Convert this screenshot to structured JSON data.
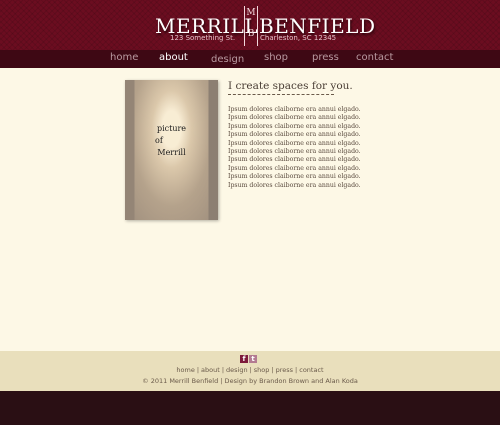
{
  "brand": {
    "name_left": "MERRILL",
    "name_right": "BENFIELD",
    "monogram_top": "M",
    "monogram_bottom": "B",
    "address_left": "123 Something St.",
    "address_right": "Charleston, SC 12345"
  },
  "nav": {
    "items": [
      {
        "label": "home",
        "active": false
      },
      {
        "label": "about",
        "active": true
      },
      {
        "label": "design",
        "active": false
      },
      {
        "label": "shop",
        "active": false
      },
      {
        "label": "press",
        "active": false
      },
      {
        "label": "contact",
        "active": false
      }
    ]
  },
  "photo": {
    "caption_line1": "picture",
    "caption_line2": "of",
    "caption_line3": "Merrill"
  },
  "content": {
    "heading": "I create spaces for you.",
    "body": "Ipsum dolores claiborne era annui elgado. Ipsum dolores claiborne era annui elgado. Ipsum dolores claiborne era annui elgado. Ipsum dolores claiborne era annui elgado. Ipsum dolores claiborne era annui elgado. Ipsum dolores claiborne era annui elgado. Ipsum dolores claiborne era annui elgado. Ipsum dolores claiborne era annui elgado. Ipsum dolores claiborne era annui elgado. Ipsum dolores claiborne era annui elgado."
  },
  "footer": {
    "social": {
      "facebook_glyph": "f",
      "twitter_glyph": "t"
    },
    "links": [
      "home",
      "about",
      "design",
      "shop",
      "press",
      "contact"
    ],
    "separator": "|",
    "copyright": "© 2011 Merrill Benfield | Design by Brandon Brown and Alan Koda"
  },
  "colors": {
    "header_bg": "#6b0d20",
    "nav_bg": "#3e0814",
    "page_bg": "#fdf8e6",
    "footer_bg": "#e9dfbc",
    "bottom_bar_bg": "#2a0f14"
  }
}
